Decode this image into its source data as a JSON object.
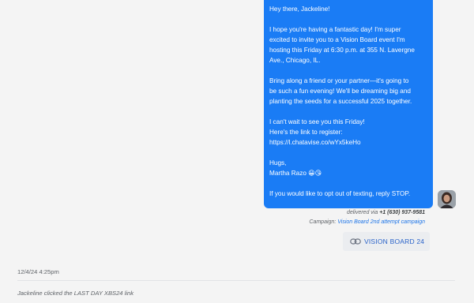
{
  "message": {
    "greeting": "Hey there, Jackeline!",
    "paragraph1": "I hope you're having a fantastic day! I'm super\nexcited to invite you to a Vision Board event I'm\nhosting this Friday at 6:30 p.m. at 355 N. Lavergne\nAve., Chicago, IL.",
    "paragraph2": "Bring along a friend or your partner—it's going to\nbe such a fun evening! We'll be dreaming big and\nplanting the seeds for a successful 2025 together.",
    "paragraph3": "I can't wait to see you this Friday!\nHere's the link to register:\nhttps://l.chatavise.co/wYx5keHo",
    "signoff": "Hugs,",
    "signature": "Martha Razo 😀😘",
    "opt_out": "If you would like to opt out of texting, reply STOP."
  },
  "meta": {
    "delivered_prefix": "delivered via",
    "delivered_number": "+1 (630) 937-9581",
    "campaign_label": "Campaign:",
    "campaign_name": "Vision Board 2nd attempt campaign"
  },
  "chip": {
    "label": "VISION BOARD 24",
    "icon": "link-icon"
  },
  "event": {
    "timestamp": "12/4/24 4:25pm",
    "activity": "Jackeline clicked the LAST DAY XBS24 link"
  },
  "colors": {
    "bubble": "#1a7cf5",
    "link": "#1a73e8",
    "background": "#f4f4f4"
  }
}
